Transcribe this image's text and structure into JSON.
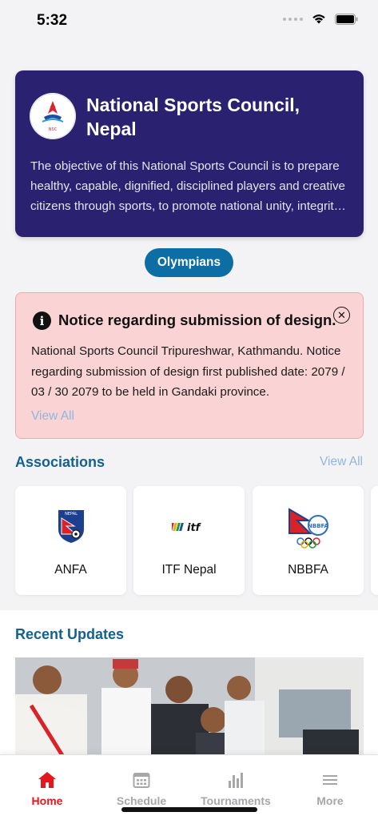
{
  "status_bar": {
    "time": "5:32"
  },
  "hero": {
    "title": "National Sports Council, Nepal",
    "description": "The objective of this National Sports Council is to prepare healthy, capable, dignified, disciplined players and creative citizens through sports, to promote national unity, integrity and international identity through sports.",
    "logo_icon": "nsc-logo-icon"
  },
  "olympians_button": "Olympians",
  "notice": {
    "title": "Notice regarding submission of design.",
    "body": "National Sports Council Tripureshwar, Kathmandu. Notice regarding submission of design first published date: 2079 / 03 / 30 2079 to be held in Gandaki province.",
    "view_all": "View All"
  },
  "associations": {
    "title": "Associations",
    "view_all": "View All",
    "items": [
      {
        "label": "ANFA",
        "icon": "anfa-logo-icon"
      },
      {
        "label": "ITF Nepal",
        "icon": "itf-logo-icon"
      },
      {
        "label": "NBBFA",
        "icon": "nbbfa-logo-icon"
      }
    ]
  },
  "recent_updates": {
    "title": "Recent Updates"
  },
  "tabs": [
    {
      "label": "Home",
      "icon": "home-icon",
      "active": true
    },
    {
      "label": "Schedule",
      "icon": "calendar-icon",
      "active": false
    },
    {
      "label": "Tournaments",
      "icon": "bar-chart-icon",
      "active": false
    },
    {
      "label": "More",
      "icon": "menu-icon",
      "active": false
    }
  ],
  "colors": {
    "hero_bg": "#2a2170",
    "accent_blue": "#0d6ea6",
    "notice_bg": "#fad4d4",
    "active_tab": "#e5161c"
  }
}
